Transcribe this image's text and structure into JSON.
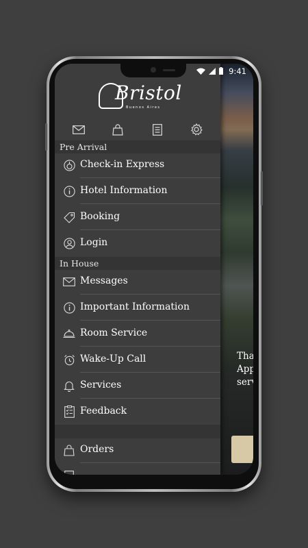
{
  "status_bar": {
    "time": "9:41"
  },
  "logo": {
    "name": "Bristol",
    "subtitle": "Buenos Aires"
  },
  "toolbar": [
    {
      "icon": "mail-icon"
    },
    {
      "icon": "shopping-bag-icon"
    },
    {
      "icon": "receipt-icon"
    },
    {
      "icon": "gear-icon"
    }
  ],
  "sections": {
    "pre_arrival": "Pre Arrival",
    "in_house": "In House"
  },
  "pre_arrival_items": [
    {
      "label": "Check-in Express",
      "icon": "check-in-icon"
    },
    {
      "label": "Hotel Information",
      "icon": "info-icon"
    },
    {
      "label": "Booking",
      "icon": "tag-icon"
    },
    {
      "label": "Login",
      "icon": "user-icon"
    }
  ],
  "in_house_items": [
    {
      "label": "Messages",
      "icon": "mail-icon"
    },
    {
      "label": "Important Information",
      "icon": "info-icon"
    },
    {
      "label": "Room Service",
      "icon": "cloche-icon"
    },
    {
      "label": "Wake-Up Call",
      "icon": "alarm-clock-icon"
    },
    {
      "label": "Services",
      "icon": "bell-icon"
    },
    {
      "label": "Feedback",
      "icon": "checklist-icon"
    }
  ],
  "extra_items": [
    {
      "label": "Orders",
      "icon": "shopping-bag-icon"
    }
  ],
  "background_text": [
    "Tha",
    "App",
    "servic"
  ],
  "colors": {
    "drawer": "#3d3d3d",
    "section_header": "#343434",
    "accent_gold": "#d7c9a5"
  }
}
